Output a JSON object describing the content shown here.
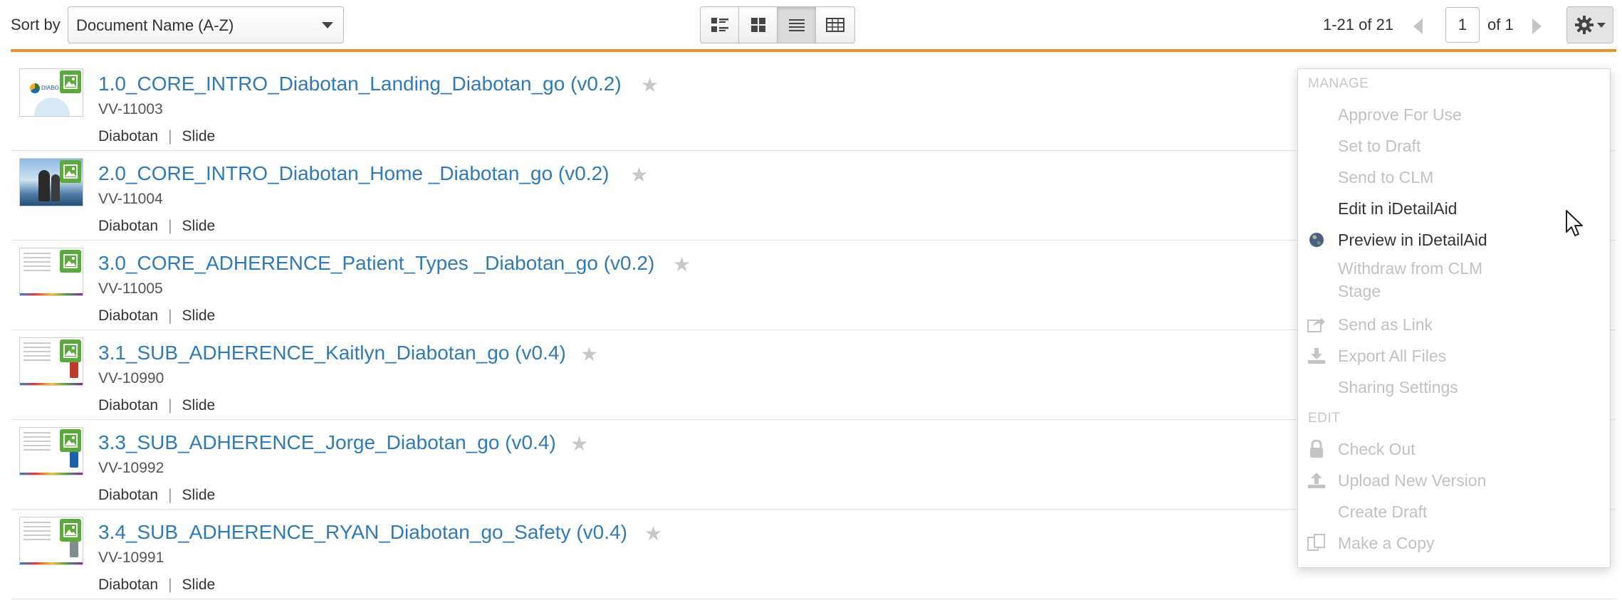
{
  "toolbar": {
    "sort_label": "Sort by",
    "sort_value": "Document Name (A-Z)",
    "views": [
      {
        "icon": "detail-list-view-icon"
      },
      {
        "icon": "grid-view-icon"
      },
      {
        "icon": "compact-list-view-icon",
        "active": true
      },
      {
        "icon": "table-view-icon"
      }
    ],
    "pager": {
      "range": "1-21 of 21",
      "page": "1",
      "of_pages": "of 1"
    },
    "settings_icon": "gear-icon",
    "accent_color": "#e8922a"
  },
  "documents": [
    {
      "title": "1.0_CORE_INTRO_Diabotan_Landing_Diabotan_go (v0.2)",
      "id": "VV-11003",
      "product": "Diabotan",
      "type": "Slide"
    },
    {
      "title": "2.0_CORE_INTRO_Diabotan_Home _Diabotan_go (v0.2)",
      "id": "VV-11004",
      "product": "Diabotan",
      "type": "Slide"
    },
    {
      "title": "3.0_CORE_ADHERENCE_Patient_Types _Diabotan_go (v0.2)",
      "id": "VV-11005",
      "product": "Diabotan",
      "type": "Slide"
    },
    {
      "title": "3.1_SUB_ADHERENCE_Kaitlyn_Diabotan_go (v0.4)",
      "id": "VV-10990",
      "product": "Diabotan",
      "type": "Slide"
    },
    {
      "title": "3.3_SUB_ADHERENCE_Jorge_Diabotan_go (v0.4)",
      "id": "VV-10992",
      "product": "Diabotan",
      "type": "Slide"
    },
    {
      "title": "3.4_SUB_ADHERENCE_RYAN_Diabotan_go_Safety (v0.4)",
      "id": "VV-10991",
      "product": "Diabotan",
      "type": "Slide"
    }
  ],
  "menu": {
    "manage_header": "MANAGE",
    "approve": "Approve For Use",
    "set_draft": "Set to Draft",
    "send_clm": "Send to CLM",
    "edit_idetailaid": "Edit in iDetailAid",
    "preview_idetailaid": "Preview in iDetailAid",
    "withdraw_clm": "Withdraw from CLM Stage",
    "send_link": "Send as Link",
    "export_files": "Export All Files",
    "sharing": "Sharing Settings",
    "edit_header": "EDIT",
    "check_out": "Check Out",
    "upload_version": "Upload New Version",
    "create_draft": "Create Draft",
    "make_copy": "Make a Copy"
  },
  "colors": {
    "link": "#2f7ab9",
    "disabled": "#c2c2c2",
    "badge_green": "#5aab3b"
  }
}
